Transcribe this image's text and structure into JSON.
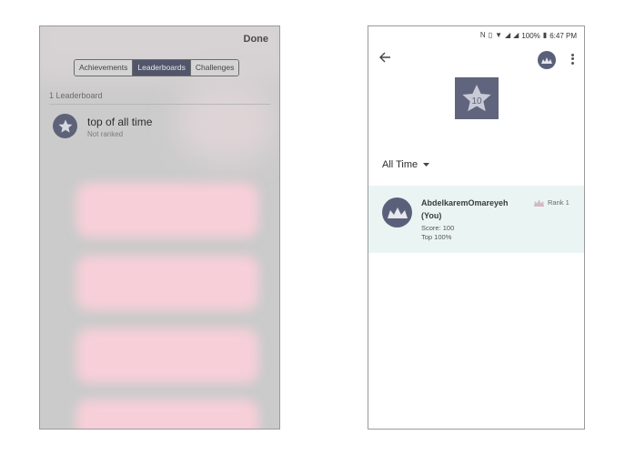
{
  "left": {
    "done_label": "Done",
    "tabs": [
      {
        "label": "Achievements",
        "active": false
      },
      {
        "label": "Leaderboards",
        "active": true
      },
      {
        "label": "Challenges",
        "active": false
      }
    ],
    "section_title": "1 Leaderboard",
    "leaderboard": {
      "name": "top of all time",
      "status": "Not ranked",
      "icon": "star-icon"
    }
  },
  "right": {
    "status_bar": {
      "battery": "100%",
      "time": "6:47 PM",
      "icons": [
        "nfc-icon",
        "vibrate-icon",
        "wifi-icon",
        "signal-icon",
        "battery-icon"
      ]
    },
    "board_badge_number": "10",
    "time_filter": "All Time",
    "player": {
      "name": "AbdelkaremOmareyeh",
      "you_label": "(You)",
      "score": "Score: 100",
      "top": "Top 100%",
      "rank": "Rank 1"
    }
  },
  "colors": {
    "accent": "#52566a",
    "player_card_bg": "#eaf5f3",
    "overlay": "#cbcbcb",
    "blur_pink": "#f7cfd9"
  }
}
